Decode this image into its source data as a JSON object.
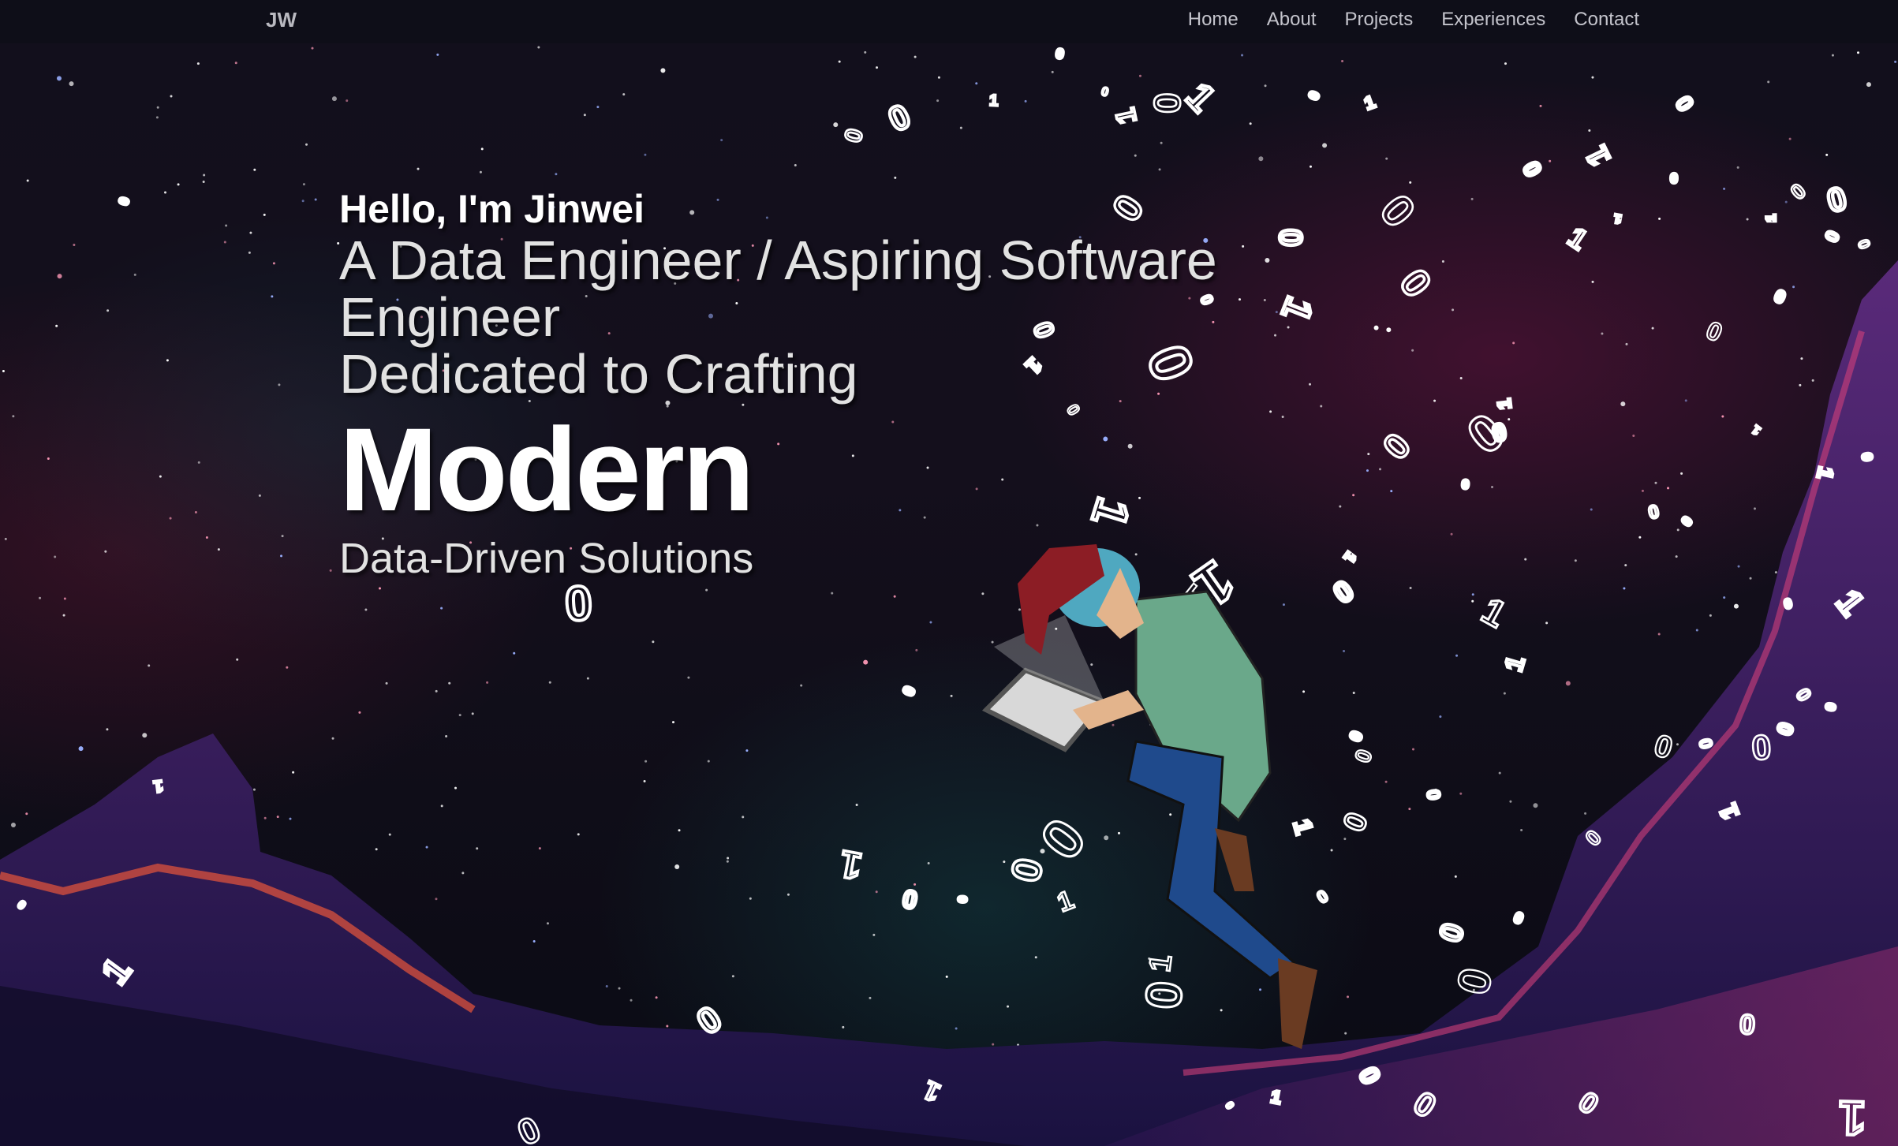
{
  "nav": {
    "logo": "JW",
    "links": [
      "Home",
      "About",
      "Projects",
      "Experiences",
      "Contact"
    ]
  },
  "hero": {
    "greeting": "Hello, I'm Jinwei",
    "role": "A Data Engineer / Aspiring Software Engineer",
    "dedicated": "Dedicated to Crafting",
    "highlight": "Modern",
    "solutions": "Data-Driven Solutions"
  },
  "illustration": {
    "subject": "astronaut-coder-floating-with-laptop",
    "glyphs": [
      "0",
      "1"
    ]
  },
  "colors": {
    "background": "#0b0b14",
    "mountain": "#4a1f6e",
    "mountain_glow": "#e8553a",
    "text": "#ffffff"
  }
}
